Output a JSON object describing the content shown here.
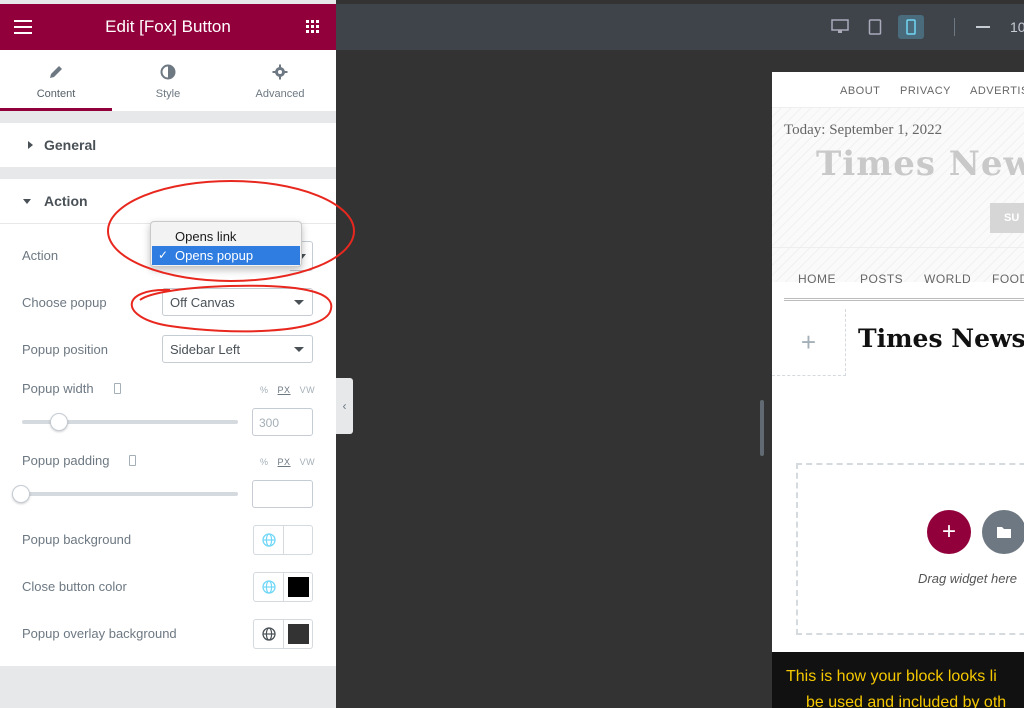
{
  "panel": {
    "title": "Edit [Fox] Button",
    "tabs": [
      {
        "label": "Content",
        "active": true
      },
      {
        "label": "Style",
        "active": false
      },
      {
        "label": "Advanced",
        "active": false
      }
    ],
    "sections": {
      "general": "General",
      "action": "Action"
    },
    "controls": {
      "action_label": "Action",
      "action_options": [
        "Opens link",
        "Opens popup"
      ],
      "action_selected": "Opens popup",
      "choose_popup_label": "Choose popup",
      "choose_popup_value": "Off Canvas",
      "popup_position_label": "Popup position",
      "popup_position_value": "Sidebar Left",
      "popup_width_label": "Popup width",
      "popup_width_value": "300",
      "popup_width_units": [
        "%",
        "PX",
        "VW"
      ],
      "popup_width_slider_fraction": 0.18,
      "popup_padding_label": "Popup padding",
      "popup_padding_value": "",
      "popup_padding_units": [
        "%",
        "PX",
        "VW"
      ],
      "popup_padding_slider_fraction": 0.0,
      "popup_background_label": "Popup background",
      "close_button_color_label": "Close button color",
      "popup_overlay_background_label": "Popup overlay background",
      "colors": {
        "accent": "#92003b",
        "popup_background": "#ffffff",
        "close_button_color": "#000000",
        "popup_overlay_background": "#333333"
      }
    }
  },
  "editor": {
    "zoom_partial": "10"
  },
  "preview": {
    "topnav": [
      "ABOUT",
      "PRIVACY",
      "ADVERTIS"
    ],
    "date": "Today: September 1, 2022",
    "masthead": "Times Newspa",
    "subscribe_partial": "SU",
    "mainnav": [
      "HOME",
      "POSTS",
      "WORLD",
      "FOOD"
    ],
    "plus": "+",
    "logo": "Times Newspa",
    "drag_text": "Drag widget here",
    "notice_line1": "This is how your block looks li",
    "notice_line2": "be used and included by oth"
  }
}
